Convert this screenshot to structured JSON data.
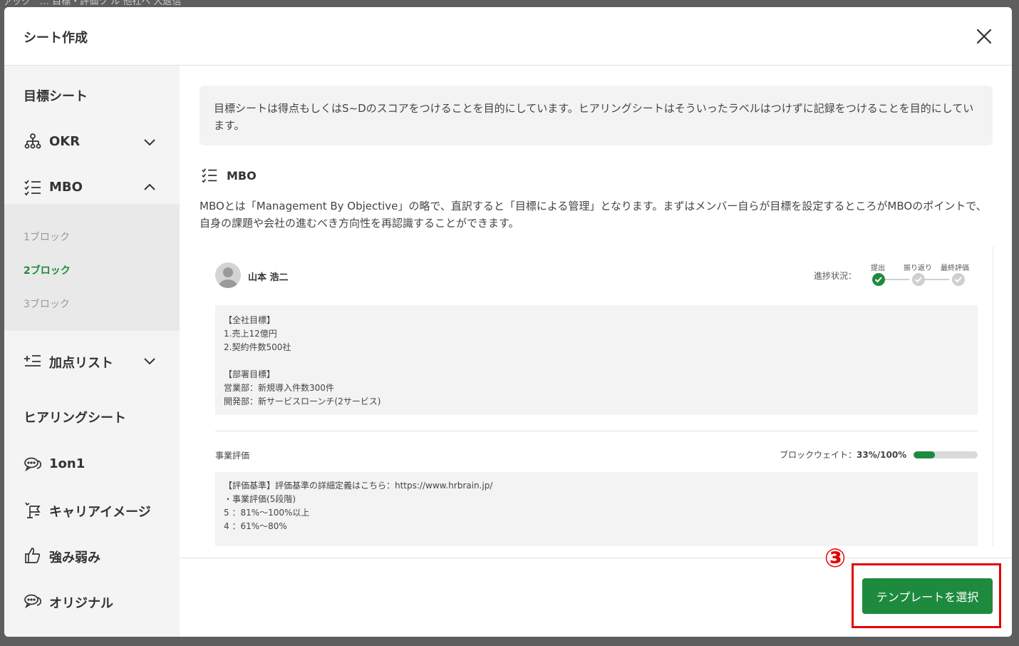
{
  "backdrop": {
    "text": "ァック　… 目標・評価ツ ル 他社へ 人返信"
  },
  "modal": {
    "title": "シート作成"
  },
  "sidebar": {
    "section_goal": "目標シート",
    "items": [
      {
        "label": "OKR",
        "icon": "org-chart-icon",
        "expanded": false
      },
      {
        "label": "MBO",
        "icon": "checklist-icon",
        "expanded": true
      },
      {
        "label": "加点リスト",
        "icon": "plus-list-icon",
        "expanded": false
      }
    ],
    "mbo_blocks": [
      "1ブロック",
      "2ブロック",
      "3ブロック"
    ],
    "active_block": "2ブロック",
    "section_hearing": "ヒアリングシート",
    "hearing_items": [
      {
        "label": "1on1",
        "icon": "chat-bubbles-icon"
      },
      {
        "label": "キャリアイメージ",
        "icon": "flag-path-icon"
      },
      {
        "label": "強み弱み",
        "icon": "thumbs-up-icon"
      },
      {
        "label": "オリジナル",
        "icon": "chat-bubbles-icon"
      }
    ]
  },
  "content": {
    "info": "目標シートは得点もしくはS~Dのスコアをつけることを目的にしています。ヒアリングシートはそういったラベルはつけずに記録をつけることを目的にしています。",
    "heading": "MBO",
    "description": "MBOとは「Management By Objective」の略で、直訳すると「目標による管理」となります。まずはメンバー自らが目標を設定するところがMBOのポイントで、自身の課題や会社の進むべき方向性を再認識することができます。",
    "preview": {
      "user_name": "山本 浩二",
      "progress_label": "進捗状況：",
      "steps": [
        {
          "label": "提出",
          "done": true
        },
        {
          "label": "振り返り",
          "done": false
        },
        {
          "label": "最終評価",
          "done": false
        }
      ],
      "goals": [
        "【全社目標】",
        "1.売上12億円",
        "2.契約件数500社",
        "",
        "【部署目標】",
        "営業部：新規導入件数300件",
        "開発部：新サービスローンチ(2サービス)"
      ],
      "eval_title": "事業評価",
      "weight_label": "ブロックウェイト：",
      "weight_value": "33%/100%",
      "weight_fraction": 0.33,
      "criteria": [
        "【評価基準】評価基準の詳細定義はこちら：https://www.hrbrain.jp/",
        "・事業評価(5段階)",
        "5 ：81%〜100%以上",
        "4 ：61%〜80%"
      ]
    }
  },
  "footer": {
    "select_button": "テンプレートを選択"
  },
  "annotation": {
    "number": "③",
    "color": "#e30000"
  },
  "colors": {
    "accent": "#1e8a3e"
  }
}
